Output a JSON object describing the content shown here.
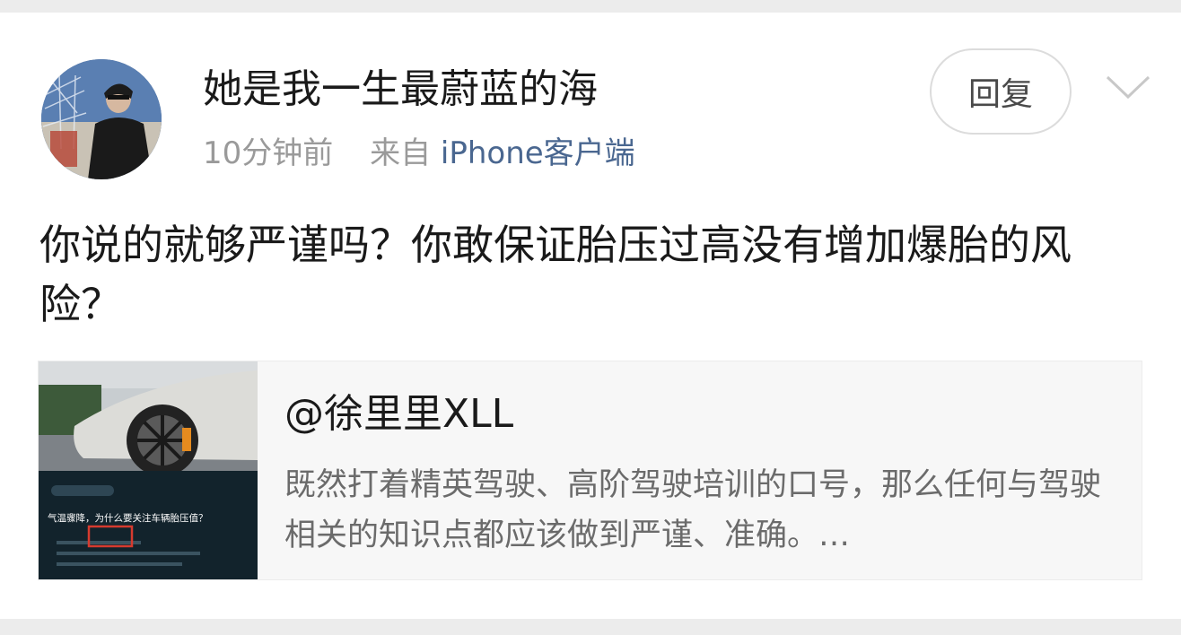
{
  "post": {
    "username": "她是我一生最蔚蓝的海",
    "time": "10分钟前",
    "source_prefix": "来自",
    "source": "iPhone客户端",
    "reply_label": "回复",
    "body": "你说的就够严谨吗？你敢保证胎压过高没有增加爆胎的风险？"
  },
  "quote": {
    "author": "@徐里里XLL",
    "excerpt": "既然打着精英驾驶、高阶驾驶培训的口号，那么任何与驾驶相关的知识点都应该做到严谨、准确。…",
    "thumb_caption": "气温骤降，为什么要关注车辆胎压值？"
  },
  "icons": {
    "more": "chevron-down-icon"
  },
  "colors": {
    "link": "#4a6790",
    "meta": "#9a9a9a",
    "text": "#1a1a1a"
  }
}
